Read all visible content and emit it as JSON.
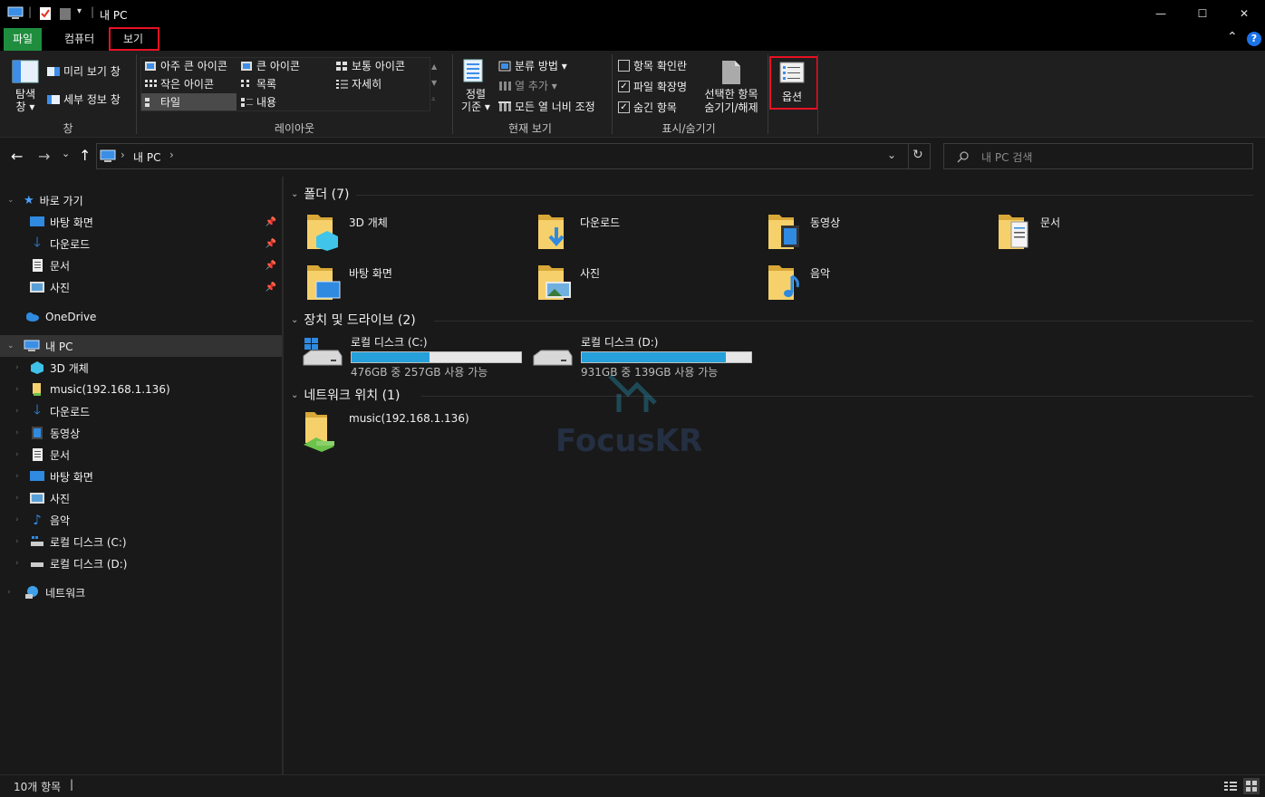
{
  "titlebar": {
    "title": "내 PC",
    "minimize": "—",
    "maximize": "☐",
    "close": "✕"
  },
  "ribbon_tabs": {
    "file": "파일",
    "computer": "컴퓨터",
    "view": "보기",
    "collapse_glyph": "⌃",
    "help_glyph": "?"
  },
  "ribbon": {
    "panes": {
      "nav_pane_line1": "탐색",
      "nav_pane_line2": "창 ▾",
      "preview": "미리 보기 창",
      "details": "세부 정보 창",
      "label": "창"
    },
    "layout": {
      "extra_large": "아주 큰 아이콘",
      "large": "큰 아이콘",
      "medium": "보통 아이콘",
      "small": "작은 아이콘",
      "list": "목록",
      "details": "자세히",
      "tiles": "타일",
      "content": "내용",
      "label": "레이아웃"
    },
    "current_view": {
      "sort_line1": "정렬",
      "sort_line2": "기준 ▾",
      "group_by": "분류 방법 ▾",
      "add_columns": "열 추가 ▾",
      "size_columns": "모든 열 너비 조정",
      "label": "현재 보기"
    },
    "show_hide": {
      "item_checkboxes": "항목 확인란",
      "file_extensions": "파일 확장명",
      "hidden_items": "숨긴 항목",
      "item_checkboxes_checked": false,
      "file_extensions_checked": true,
      "hidden_items_checked": true,
      "hide_selected_line1": "선택한 항목",
      "hide_selected_line2": "숨기기/해제",
      "label": "표시/숨기기"
    },
    "options": {
      "label": "옵션"
    }
  },
  "address": {
    "back": "←",
    "forward": "→",
    "recent": "⌄",
    "up": "↑",
    "crumb_sep1": "›",
    "crumb": "내 PC",
    "crumb_sep2": "›",
    "dropdown": "⌄",
    "refresh": "↻",
    "search_placeholder": "내 PC 검색"
  },
  "nav": {
    "quick_access": "바로 가기",
    "quick_items": [
      "바탕 화면",
      "다운로드",
      "문서",
      "사진"
    ],
    "onedrive": "OneDrive",
    "this_pc": "내 PC",
    "pc_items": [
      "3D 개체",
      "music(192.168.1.136)",
      "다운로드",
      "동영상",
      "문서",
      "바탕 화면",
      "사진",
      "음악",
      "로컬 디스크 (C:)",
      "로컬 디스크 (D:)"
    ],
    "network": "네트워크"
  },
  "content": {
    "folders_header": "폴더 (7)",
    "folders": [
      "3D 개체",
      "다운로드",
      "동영상",
      "문서",
      "바탕 화면",
      "사진",
      "음악"
    ],
    "drives_header": "장치 및 드라이브 (2)",
    "drives": [
      {
        "name": "로컬 디스크 (C:)",
        "info": "476GB 중 257GB 사용 가능",
        "used_fraction": 0.46
      },
      {
        "name": "로컬 디스크 (D:)",
        "info": "931GB 중 139GB 사용 가능",
        "used_fraction": 0.85
      }
    ],
    "network_header": "네트워크 위치 (1)",
    "network_items": [
      "music(192.168.1.136)"
    ],
    "watermark": "FocusKR"
  },
  "status": {
    "count": "10개 항목",
    "divider": "|"
  },
  "colors": {
    "accent_file_tab": "#1e8e3e",
    "highlight_box": "#e81123",
    "drive_bar_fill": "#26a0da",
    "background": "#191919"
  }
}
